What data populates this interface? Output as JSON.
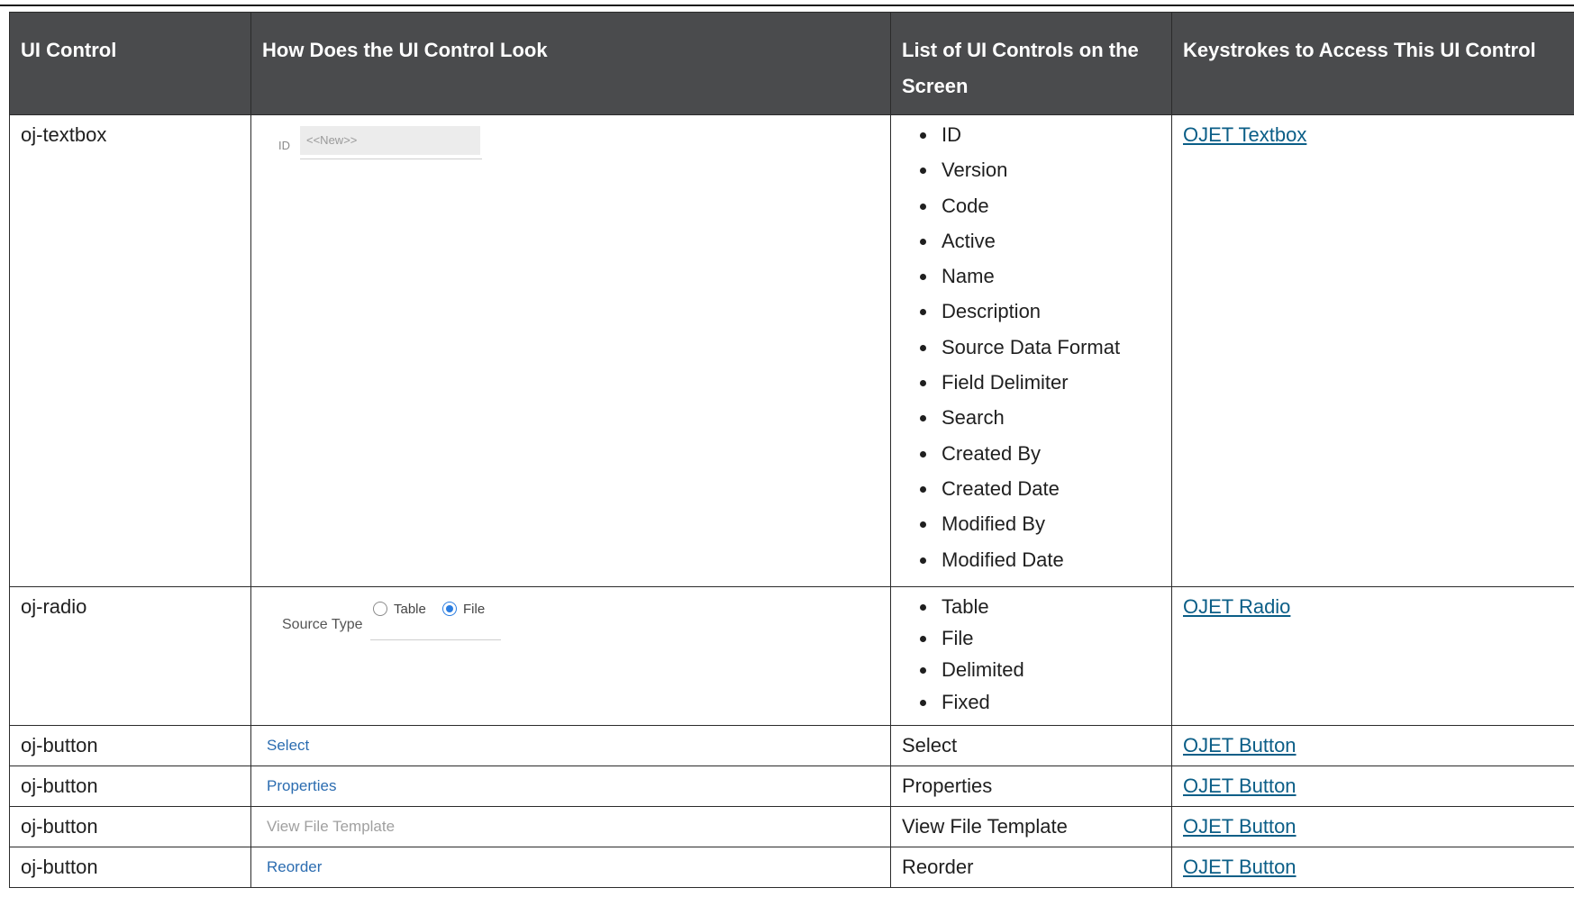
{
  "table": {
    "headers": [
      "UI Control",
      "How Does the UI Control Look",
      "List of UI Controls on the Screen",
      "Keystrokes to Access This UI Control"
    ],
    "rows": [
      {
        "control": "oj-textbox",
        "mock": {
          "label": "ID",
          "placeholder": "<<New>>"
        },
        "items": [
          "ID",
          "Version",
          "Code",
          "Active",
          "Name",
          "Description",
          "Source Data Format",
          "Field Delimiter",
          "Search",
          "Created By",
          "Created Date",
          "Modified By",
          "Modified Date"
        ],
        "link": "OJET Textbox"
      },
      {
        "control": "oj-radio",
        "mock": {
          "label": "Source Type",
          "option1": "Table",
          "option2": "File"
        },
        "items": [
          "Table",
          "File",
          "Delimited",
          "Fixed"
        ],
        "link": "OJET Radio"
      },
      {
        "control": "oj-button",
        "mock": {
          "label": "Select"
        },
        "item": "Select",
        "link": "OJET Button"
      },
      {
        "control": "oj-button",
        "mock": {
          "label": "Properties"
        },
        "item": "Properties",
        "link": "OJET Button"
      },
      {
        "control": "oj-button",
        "mock": {
          "label": "View File Template"
        },
        "item": "View File Template",
        "link": "OJET Button"
      },
      {
        "control": "oj-button",
        "mock": {
          "label": "Reorder"
        },
        "item": "Reorder",
        "link": "OJET Button"
      }
    ]
  },
  "colors": {
    "header_bg": "#4a4b4d",
    "link": "#0b5e87",
    "button_text": "#2b6cb0",
    "radio_selected": "#2a7de1"
  }
}
